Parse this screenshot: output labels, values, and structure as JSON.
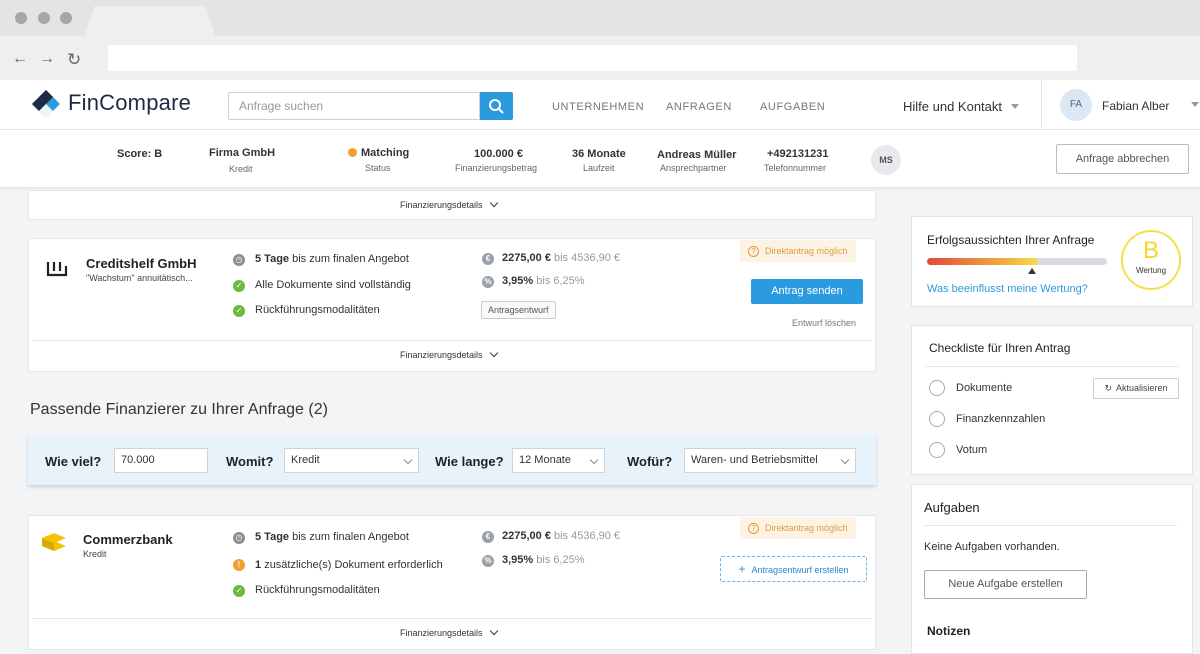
{
  "header": {
    "brand": "FinCompare",
    "search_placeholder": "Anfrage suchen",
    "nav": [
      "UNTERNEHMEN",
      "ANFRAGEN",
      "AUFGABEN"
    ],
    "help": "Hilfe und Kontakt",
    "user_initials": "FA",
    "user_name": "Fabian Alber"
  },
  "summary": {
    "score": "Score: B",
    "company": "Firma GmbH",
    "company_sub": "Kredit",
    "status": "Matching",
    "status_label": "Status",
    "status_color": "#f0a030",
    "amount": "100.000 €",
    "amount_label": "Finanzierungsbetrag",
    "duration": "36 Monate",
    "duration_label": "Laufzeit",
    "contact": "Andreas Müller",
    "contact_label": "Ansprechpartner",
    "phone": "+492131231",
    "phone_label": "Telefonnummer",
    "agent_initials": "MS",
    "cancel": "Anfrage abbrechen"
  },
  "details_label": "Finanzierungsdetails",
  "card_creditshelf": {
    "name": "Creditshelf GmbH",
    "product": "\"Wachstum\" annuitätisch...",
    "days_bold": "5 Tage",
    "days_rest": "bis zum finalen Angebot",
    "docs": "Alle Dokumente sind vollständig",
    "repay": "Rückführungsmodalitäten",
    "rate_bold": "2275,00 €",
    "rate_rest": "bis 4536,90 €",
    "pct_bold": "3,95%",
    "pct_rest": "bis 6,25%",
    "tag": "Antragsentwurf",
    "badge": "Direktantrag möglich",
    "send": "Antrag senden",
    "delete": "Entwurf löschen"
  },
  "section_title": "Passende Finanzierer zu Ihrer Anfrage (2)",
  "filter": {
    "q1": "Wie viel?",
    "v1": "70.000",
    "q2": "Womit?",
    "v2": "Kredit",
    "q3": "Wie lange?",
    "v3": "12 Monate",
    "q4": "Wofür?",
    "v4": "Waren- und Betriebsmittel"
  },
  "card_commerz": {
    "name": "Commerzbank",
    "product": "Kredit",
    "days_bold": "5 Tage",
    "days_rest": "bis zum finalen Angebot",
    "docs_bold": "1",
    "docs_rest": "zusätzliche(s) Dokument erforderlich",
    "repay": "Rückführungsmodalitäten",
    "rate_bold": "2275,00 €",
    "rate_rest": "bis 4536,90 €",
    "pct_bold": "3,95%",
    "pct_rest": "bis 6,25%",
    "badge": "Direktantrag möglich",
    "draft": "Antragsentwurf erstellen"
  },
  "success": {
    "title": "Erfolgsaussichten Ihrer Anfrage",
    "link": "Was beeinflusst meine Wertung?",
    "grade": "B",
    "grade_label": "Wertung",
    "gauge_level": 0.61
  },
  "checklist": {
    "title": "Checkliste für Ihren Antrag",
    "refresh": "Aktualisieren",
    "items": [
      "Dokumente",
      "Finanzkennzahlen",
      "Votum"
    ]
  },
  "tasks": {
    "title": "Aufgaben",
    "empty": "Keine Aufgaben vorhanden.",
    "new": "Neue Aufgabe erstellen"
  },
  "notes": {
    "title": "Notizen"
  },
  "colors": {
    "accent": "#2c9adf",
    "ok": "#6cbb3c",
    "warn": "#f0a030",
    "grade": "#f3e04a"
  }
}
